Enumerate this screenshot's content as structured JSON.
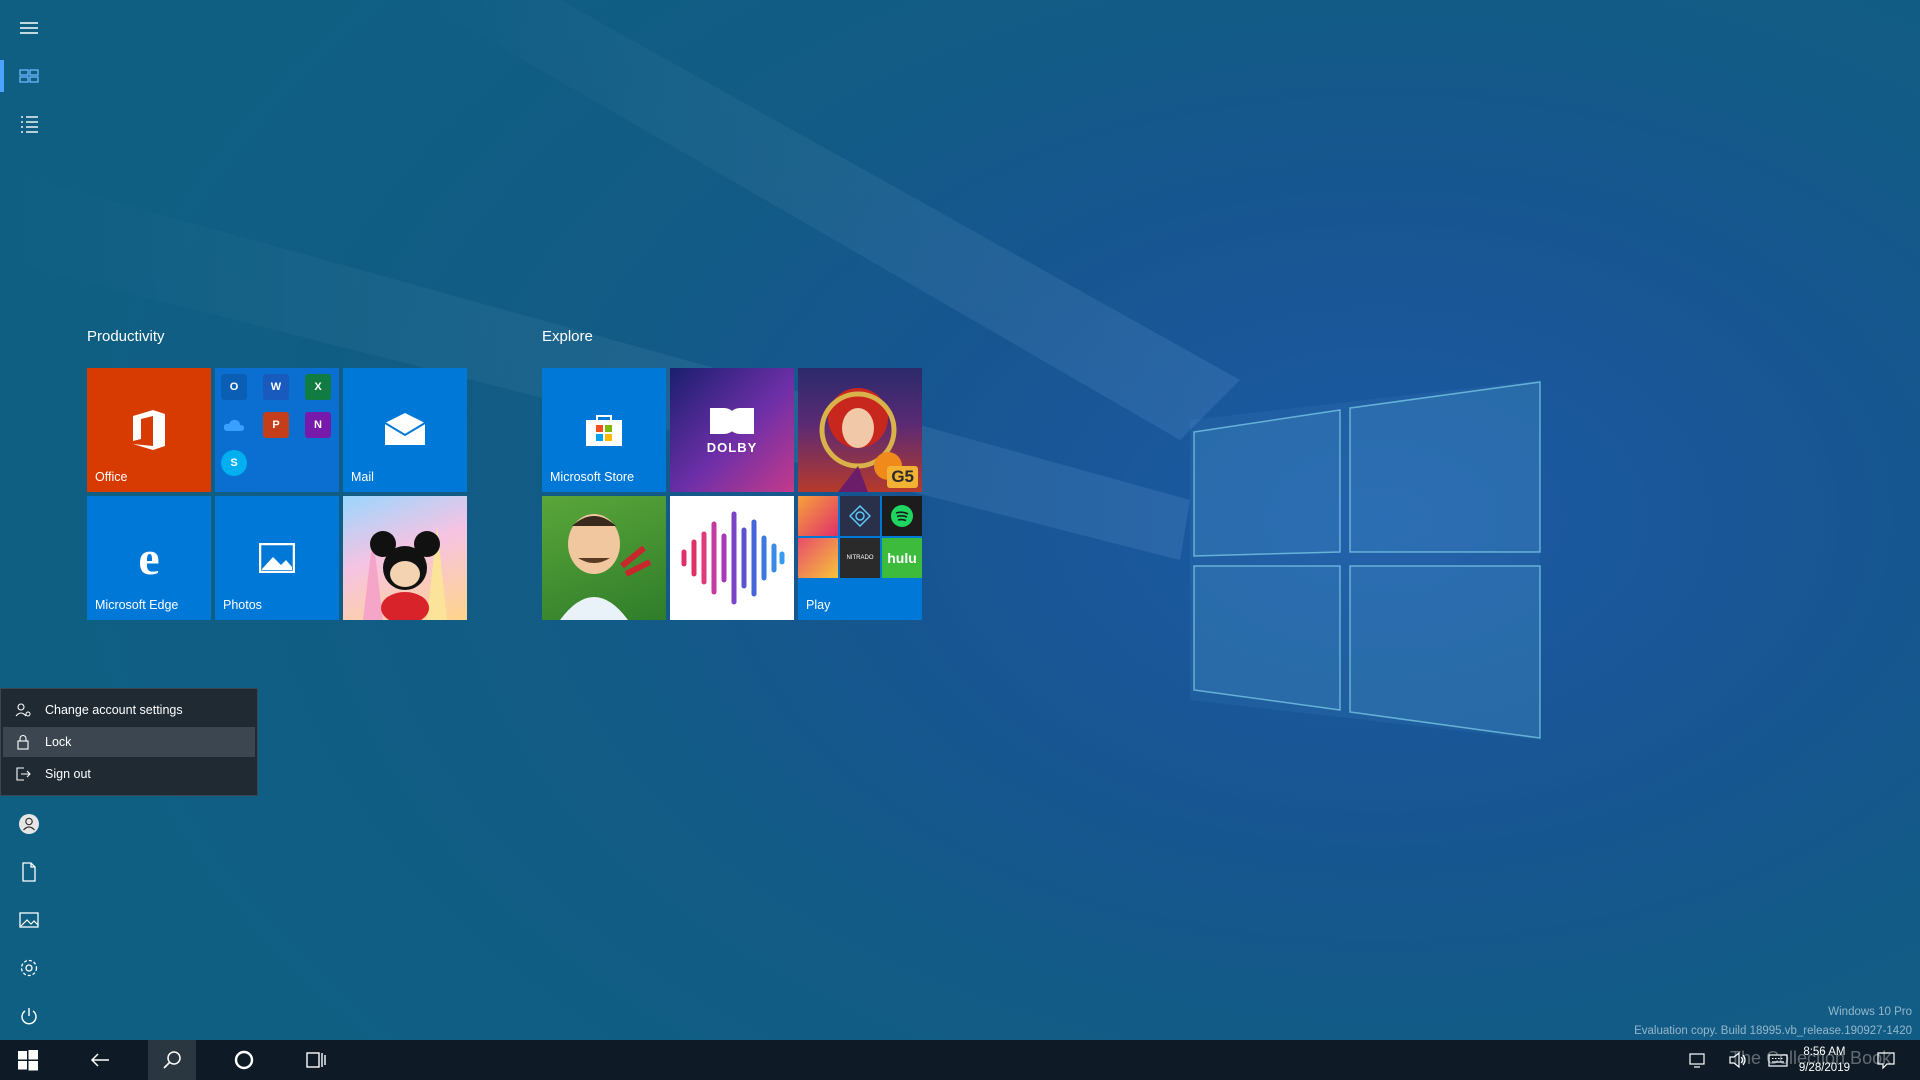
{
  "groups": [
    {
      "title": "Productivity"
    },
    {
      "title": "Explore"
    }
  ],
  "tiles": {
    "office": {
      "label": "Office"
    },
    "mail": {
      "label": "Mail"
    },
    "edge": {
      "label": "Microsoft Edge"
    },
    "photos": {
      "label": "Photos"
    },
    "store": {
      "label": "Microsoft Store"
    },
    "dolby": {
      "logo_text": "DOLBY"
    },
    "game_badge": {
      "text": "G5"
    },
    "play": {
      "label": "Play",
      "mini": {
        "spotify": "spotify",
        "hulu": "hulu",
        "nitrado": "NITRADO"
      }
    },
    "office_apps": {
      "outlook": "O",
      "word": "W",
      "excel": "X",
      "powerpoint": "P",
      "onenote": "N",
      "skype": "S"
    }
  },
  "account_menu": {
    "items": [
      {
        "label": "Change account settings"
      },
      {
        "label": "Lock"
      },
      {
        "label": "Sign out"
      }
    ]
  },
  "clock": {
    "time": "8:56 AM",
    "date": "9/28/2019"
  },
  "watermark": {
    "edition": "Windows 10 Pro",
    "build": "Evaluation copy. Build 18995.vb_release.190927-1420"
  },
  "overlay_text": "The Collection Book",
  "colors": {
    "office": "#d83b01",
    "tile_blue": "#0078d7",
    "menu_bg": "#1f2a33",
    "taskbar": "#0e1b26"
  }
}
